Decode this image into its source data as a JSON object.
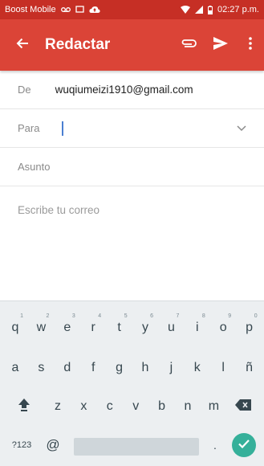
{
  "status_bar": {
    "carrier": "Boost Mobile",
    "time": "02:27 p.m."
  },
  "app_bar": {
    "title": "Redactar"
  },
  "compose": {
    "from_label": "De",
    "from_value": "wuqiumeizi1910@gmail.com",
    "to_label": "Para",
    "subject_placeholder": "Asunto",
    "body_placeholder": "Escribe tu correo"
  },
  "keyboard": {
    "row1": [
      "q",
      "w",
      "e",
      "r",
      "t",
      "y",
      "u",
      "i",
      "o",
      "p"
    ],
    "row1_hints": [
      "1",
      "2",
      "3",
      "4",
      "5",
      "6",
      "7",
      "8",
      "9",
      "0"
    ],
    "row2": [
      "a",
      "s",
      "d",
      "f",
      "g",
      "h",
      "j",
      "k",
      "l",
      "ñ"
    ],
    "row3": [
      "z",
      "x",
      "c",
      "v",
      "b",
      "n",
      "m"
    ],
    "symbols_label": "?123",
    "at_label": "@",
    "period_label": "."
  },
  "colors": {
    "status_bar": "#c62f25",
    "app_bar": "#db4437",
    "accent": "#4a7fd1",
    "enter": "#35b09a"
  }
}
